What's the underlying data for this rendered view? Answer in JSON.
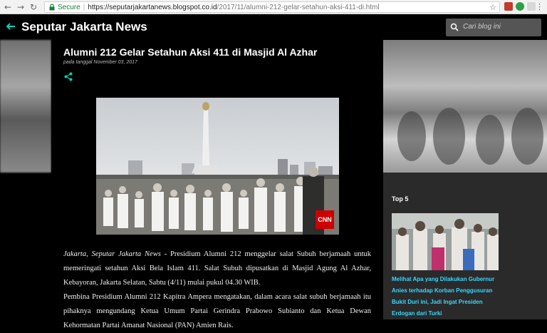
{
  "browser": {
    "secure_label": "Secure",
    "url_host": "https://seputarjakartanews.blogspot.co.id",
    "url_path": "/2017/11/alumni-212-gelar-setahun-aksi-411-di.html"
  },
  "blog": {
    "title": "Seputar Jakarta News",
    "search_placeholder": "Cari blog ini"
  },
  "post": {
    "title": "Alumni 212 Gelar Setahun Aksi 411 di Masjid Al Azhar",
    "date": "pada tanggal November 03, 2017",
    "image_badge": "CNN",
    "lead": "Jakarta, Seputar Jakarta News",
    "paragraph1": " - Presidium Alumni 212 menggelar salat Subuh berjamaah untuk memeringati setahun Aksi Bela Islam 411. Salat Subuh dipusatkan di Masjid Agung Al Azhar, Kebayoran, Jakarta Selatan, Sabtu (4/11) mulai pukul 04.30 WIB.",
    "paragraph2": "Pembina Presidium Alumni 212 Kapitra Ampera mengatakan, dalam acara salat subuh berjamaah itu pihaknya mengundang Ketua Umum Partai Gerindra Prabowo Subianto dan Ketua Dewan Kehormatan Partai Amanat Nasional (PAN) Amien Rais."
  },
  "sidebar": {
    "heading": "Top 5",
    "top_link": "Melihat Apa yang Dilakukan Gubernur Anies terhadap Korban Penggusuran Bukit Duri ini, Jadi Ingat Presiden Erdogan dari Turki"
  },
  "colors": {
    "accent": "#00d2be",
    "link": "#38d8ff",
    "secure": "#188038",
    "cnn": "#cc0000"
  },
  "icons": [
    "back-icon",
    "forward-icon",
    "reload-icon",
    "home-icon",
    "lock-icon",
    "star-icon",
    "menu-icon",
    "back-arrow-icon",
    "search-icon",
    "share-icon"
  ]
}
